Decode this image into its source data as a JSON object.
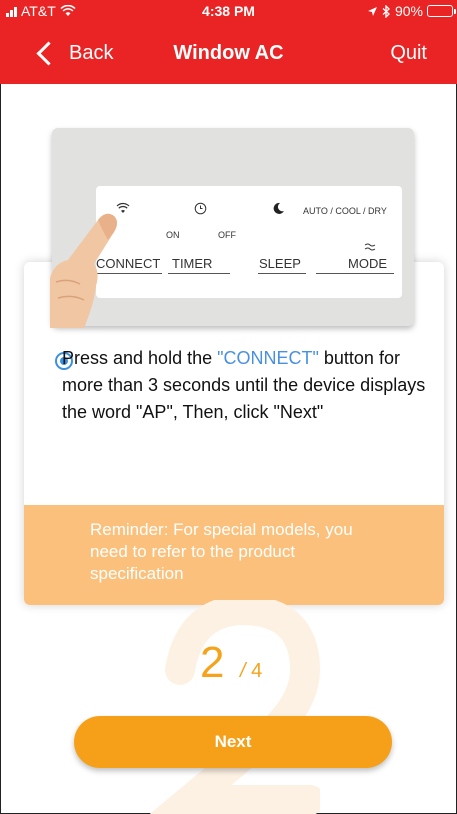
{
  "status": {
    "carrier": "AT&T",
    "time": "4:38 PM",
    "battery": "90%",
    "battery_level": 0.9
  },
  "nav": {
    "back_label": "Back",
    "title": "Window AC",
    "quit_label": "Quit"
  },
  "panel": {
    "connect": "CONNECT",
    "timer": "TIMER",
    "sleep": "SLEEP",
    "mode": "MODE",
    "on": "ON",
    "off": "OFF",
    "modes": "AUTO / COOL / DRY"
  },
  "instruction": {
    "prefix": "Press and hold the ",
    "highlight": "\"CONNECT\"",
    "suffix": " button for more than 3 seconds until the device displays the word \"AP\", Then, click \"Next\""
  },
  "reminder": "Reminder: For special models, you need to refer to the product specification",
  "step": {
    "current": "2",
    "total": "4",
    "separator": "/"
  },
  "next_label": "Next",
  "colors": {
    "header": "#ea2324",
    "accent": "#f6a01a",
    "reminder_bg": "#fbc07b",
    "link": "#4a90e2"
  }
}
